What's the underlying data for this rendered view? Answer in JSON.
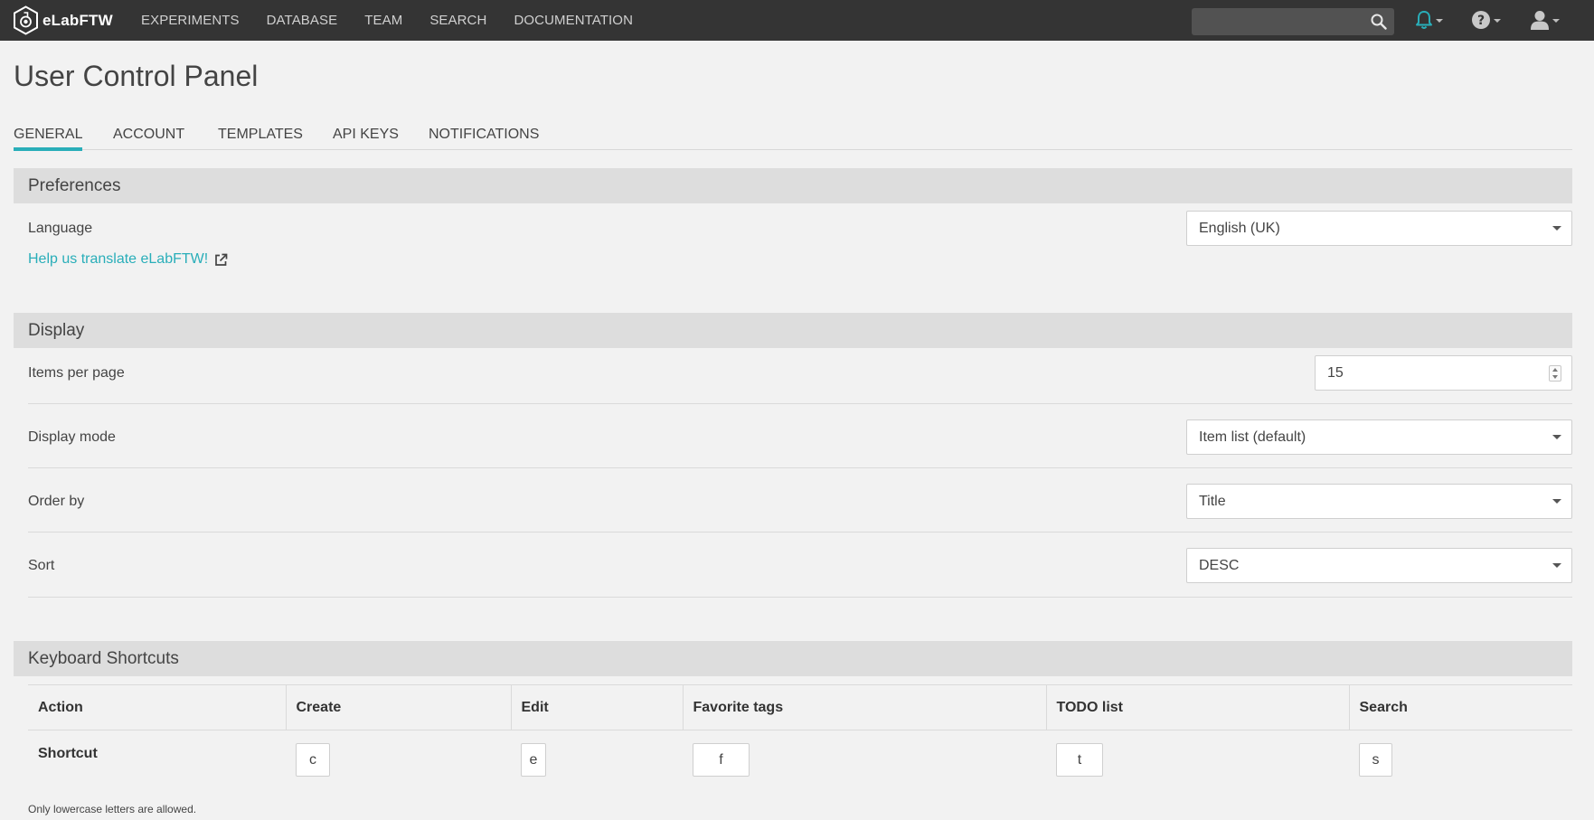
{
  "nav": {
    "brand": "eLabFTW",
    "links": [
      "EXPERIMENTS",
      "DATABASE",
      "TEAM",
      "SEARCH",
      "DOCUMENTATION"
    ],
    "search_placeholder": "",
    "icons": [
      "search-icon",
      "bell-icon",
      "question-circle-icon",
      "user-icon"
    ],
    "accent_color": "#29aeb9"
  },
  "page": {
    "title": "User Control Panel",
    "tabs": [
      "GENERAL",
      "ACCOUNT",
      "TEMPLATES",
      "API KEYS",
      "NOTIFICATIONS"
    ],
    "active_tab": "GENERAL"
  },
  "preferences": {
    "heading": "Preferences",
    "language_label": "Language",
    "language_value": "English (UK)",
    "help_link": "Help us translate eLabFTW!"
  },
  "display": {
    "heading": "Display",
    "items_per_page_label": "Items per page",
    "items_per_page_value": "15",
    "display_mode_label": "Display mode",
    "display_mode_value": "Item list (default)",
    "order_by_label": "Order by",
    "order_by_value": "Title",
    "sort_label": "Sort",
    "sort_value": "DESC"
  },
  "shortcuts": {
    "heading": "Keyboard Shortcuts",
    "headers": [
      "Action",
      "Create",
      "Edit",
      "Favorite tags",
      "TODO list",
      "Search"
    ],
    "row_label": "Shortcut",
    "keys": [
      "c",
      "e",
      "f",
      "t",
      "s"
    ],
    "note": "Only lowercase letters are allowed."
  }
}
